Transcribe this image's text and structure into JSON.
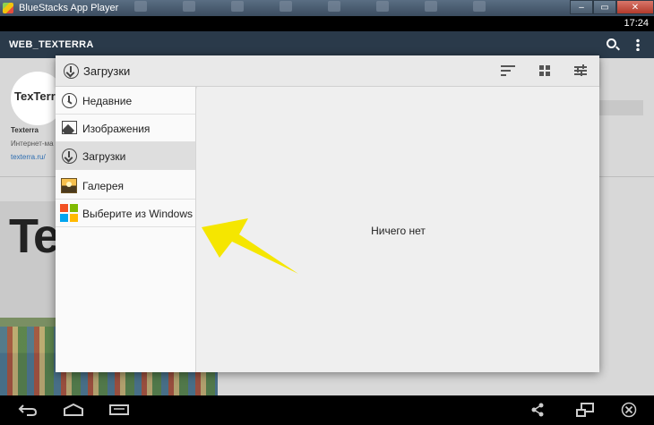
{
  "window": {
    "title": "BlueStacks App Player",
    "clock": "17:24"
  },
  "background_app": {
    "title": "WEB_TEXTERRA",
    "profile_logo_text": "TexTerra",
    "profile_name": "Texterra",
    "profile_desc": "Интернет-ма",
    "profile_url": "texterra.ru/",
    "photo_text": "Tex"
  },
  "dialog": {
    "title": "Загрузки",
    "nav": [
      {
        "label": "Недавние",
        "icon": "clock-icon"
      },
      {
        "label": "Изображения",
        "icon": "image-icon"
      },
      {
        "label": "Загрузки",
        "icon": "download-icon",
        "active": true
      },
      {
        "label": "Галерея",
        "icon": "gallery-icon"
      },
      {
        "label": "Выберите из Windows",
        "icon": "windows-icon"
      }
    ],
    "empty_message": "Ничего нет"
  },
  "colors": {
    "annotation_arrow": "#f5e600",
    "dialog_bg": "#efefef",
    "active_item": "#dedede"
  }
}
